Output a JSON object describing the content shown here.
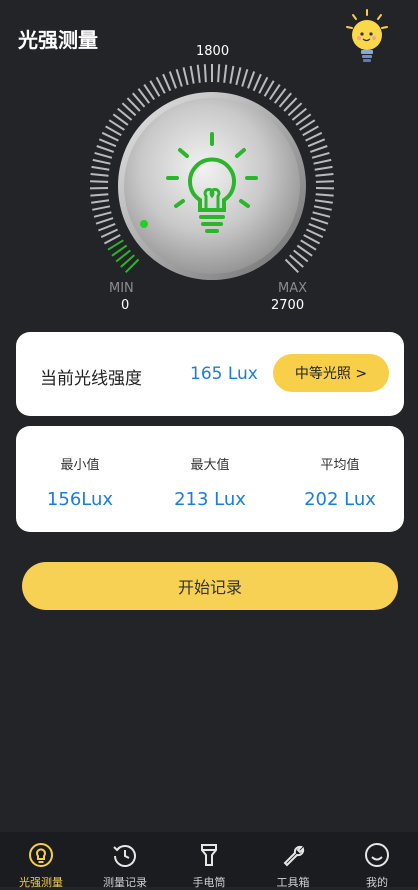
{
  "header": {
    "title": "光强测量"
  },
  "gauge": {
    "scale_max_top": "1800",
    "min_label": "MIN",
    "min_value": "0",
    "max_label": "MAX",
    "max_value": "2700",
    "fill_fraction": 0.061,
    "accent_color": "#2bb52b"
  },
  "current": {
    "label": "当前光线强度",
    "value": "165 Lux",
    "level_button": "中等光照 >"
  },
  "stats": {
    "min_label": "最小值",
    "min_value": "156Lux",
    "max_label": "最大值",
    "max_value": "213 Lux",
    "avg_label": "平均值",
    "avg_value": "202 Lux"
  },
  "actions": {
    "start_label": "开始记录"
  },
  "tabs": [
    {
      "label": "光强测量",
      "icon": "lightbulb-icon",
      "active": true
    },
    {
      "label": "测量记录",
      "icon": "history-icon",
      "active": false
    },
    {
      "label": "手电筒",
      "icon": "flashlight-icon",
      "active": false
    },
    {
      "label": "工具箱",
      "icon": "wrench-icon",
      "active": false
    },
    {
      "label": "我的",
      "icon": "smile-icon",
      "active": false
    }
  ],
  "colors": {
    "accent_yellow": "#f7cf48",
    "value_blue": "#1a7de0",
    "background": "#232427"
  }
}
